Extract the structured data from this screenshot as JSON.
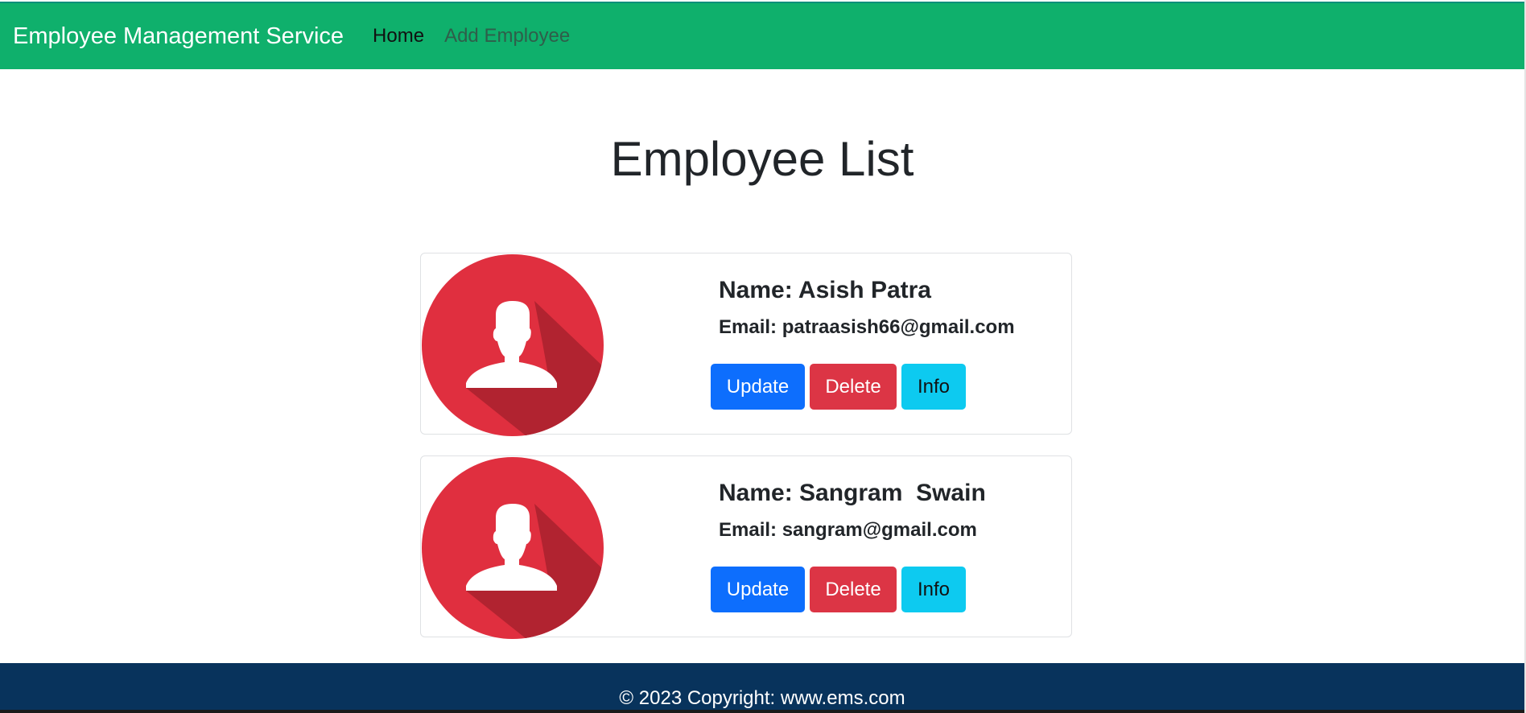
{
  "navbar": {
    "brand": "Employee Management Service",
    "links": [
      {
        "label": "Home",
        "active": true
      },
      {
        "label": "Add Employee",
        "active": false
      }
    ],
    "color": "#0fb06c"
  },
  "main": {
    "title": "Employee List",
    "employees": [
      {
        "name": "Name: Asish Patra",
        "email": "Email: patraasish66@gmail.com",
        "buttons": {
          "update": "Update",
          "delete": "Delete",
          "info": "Info"
        }
      },
      {
        "name": "Name: Sangram  Swain",
        "email": "Email: sangram@gmail.com",
        "buttons": {
          "update": "Update",
          "delete": "Delete",
          "info": "Info"
        }
      }
    ]
  },
  "footer": {
    "text": "© 2023 Copyright: www.ems.com",
    "color": "#08335c"
  },
  "icons": {
    "avatar": "user-avatar-icon"
  },
  "colors": {
    "update": "#0d6efd",
    "delete": "#dc3545",
    "info": "#0dcaf0",
    "avatar_bg": "#e02f3f"
  }
}
